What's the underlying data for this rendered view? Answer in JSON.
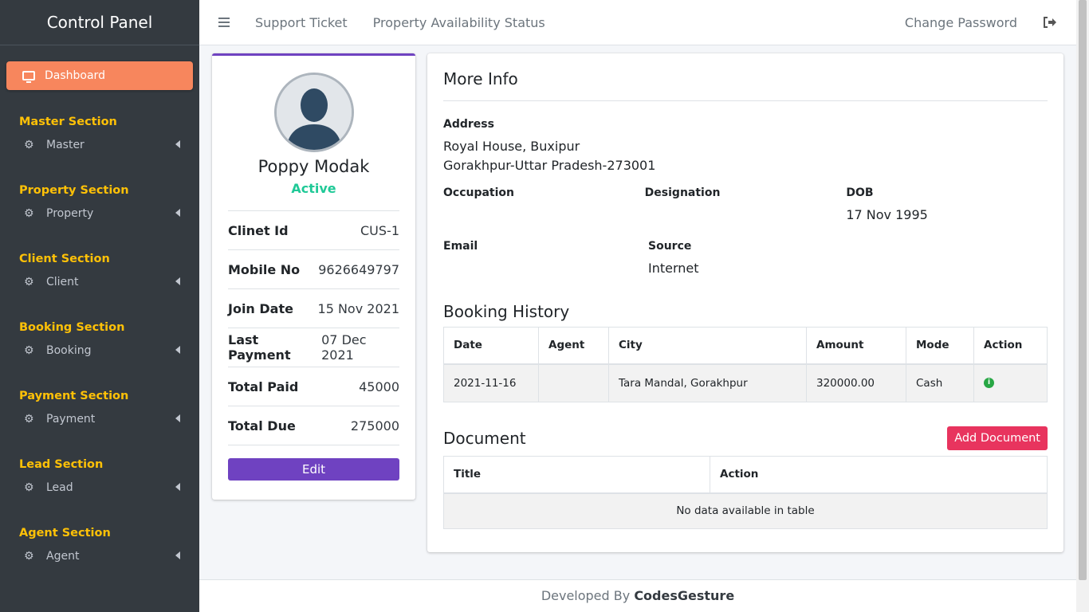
{
  "sidebar": {
    "brand": "Control Panel",
    "dashboard": "Dashboard",
    "sections": [
      {
        "heading": "Master Section",
        "item": "Master"
      },
      {
        "heading": "Property Section",
        "item": "Property"
      },
      {
        "heading": "Client Section",
        "item": "Client"
      },
      {
        "heading": "Booking Section",
        "item": "Booking"
      },
      {
        "heading": "Payment Section",
        "item": "Payment"
      },
      {
        "heading": "Lead Section",
        "item": "Lead"
      },
      {
        "heading": "Agent Section",
        "item": "Agent"
      }
    ]
  },
  "topbar": {
    "support": "Support Ticket",
    "availability": "Property Availability Status",
    "change_password": "Change Password"
  },
  "profile": {
    "name": "Poppy Modak",
    "status": "Active",
    "rows": [
      {
        "label": "Clinet Id",
        "value": "CUS-1"
      },
      {
        "label": "Mobile No",
        "value": "9626649797"
      },
      {
        "label": "Join Date",
        "value": "15 Nov 2021"
      },
      {
        "label": "Last Payment",
        "value": "07 Dec 2021"
      },
      {
        "label": "Total Paid",
        "value": "45000"
      },
      {
        "label": "Total Due",
        "value": "275000"
      }
    ],
    "edit_label": "Edit"
  },
  "info": {
    "title": "More Info",
    "address_label": "Address",
    "address_line1": "Royal House, Buxipur",
    "address_line2": "Gorakhpur-Uttar Pradesh-273001",
    "occupation_label": "Occupation",
    "occupation": "",
    "designation_label": "Designation",
    "designation": "",
    "dob_label": "DOB",
    "dob": "17 Nov 1995",
    "email_label": "Email",
    "email": "",
    "source_label": "Source",
    "source": "Internet"
  },
  "booking": {
    "title": "Booking History",
    "headers": [
      "Date",
      "Agent",
      "City",
      "Amount",
      "Mode",
      "Action"
    ],
    "rows": [
      {
        "date": "2021-11-16",
        "agent": "",
        "city": "Tara Mandal, Gorakhpur",
        "amount": "320000.00",
        "mode": "Cash",
        "action_icon": "info-icon"
      }
    ]
  },
  "document": {
    "title": "Document",
    "add_label": "Add Document",
    "headers": [
      "Title",
      "Action"
    ],
    "empty": "No data available in table"
  },
  "footer": {
    "prefix": "Developed By",
    "company": "CodesGesture"
  },
  "colors": {
    "sidebar_bg": "#343a40",
    "accent_orange": "#f7865d",
    "section_yellow": "#ffc107",
    "purple": "#6f42c1",
    "status_green": "#20c997",
    "add_doc_pink": "#e8345e"
  }
}
